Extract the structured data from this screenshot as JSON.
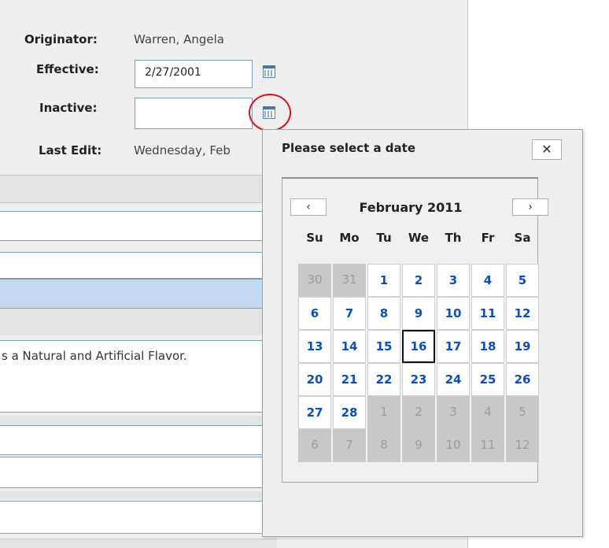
{
  "form": {
    "originator_label": "Originator:",
    "originator_value": "Warren, Angela",
    "effective_label": "Effective:",
    "effective_value": "2/27/2001",
    "inactive_label": "Inactive:",
    "inactive_value": "",
    "last_edit_label": "Last Edit:",
    "last_edit_value": "Wednesday, Feb",
    "description_text": "s a Natural and Artificial Flavor."
  },
  "popup": {
    "title": "Please select a date",
    "close_label": "✕",
    "prev_label": "‹",
    "next_label": "›",
    "month_label": "February 2011",
    "weekdays": [
      "Su",
      "Mo",
      "Tu",
      "We",
      "Th",
      "Fr",
      "Sa"
    ],
    "weeks": [
      [
        {
          "d": "30",
          "cur": false
        },
        {
          "d": "31",
          "cur": false
        },
        {
          "d": "1",
          "cur": true
        },
        {
          "d": "2",
          "cur": true
        },
        {
          "d": "3",
          "cur": true
        },
        {
          "d": "4",
          "cur": true
        },
        {
          "d": "5",
          "cur": true
        }
      ],
      [
        {
          "d": "6",
          "cur": true
        },
        {
          "d": "7",
          "cur": true
        },
        {
          "d": "8",
          "cur": true
        },
        {
          "d": "9",
          "cur": true
        },
        {
          "d": "10",
          "cur": true
        },
        {
          "d": "11",
          "cur": true
        },
        {
          "d": "12",
          "cur": true
        }
      ],
      [
        {
          "d": "13",
          "cur": true
        },
        {
          "d": "14",
          "cur": true
        },
        {
          "d": "15",
          "cur": true
        },
        {
          "d": "16",
          "cur": true,
          "today": true
        },
        {
          "d": "17",
          "cur": true
        },
        {
          "d": "18",
          "cur": true
        },
        {
          "d": "19",
          "cur": true
        }
      ],
      [
        {
          "d": "20",
          "cur": true
        },
        {
          "d": "21",
          "cur": true
        },
        {
          "d": "22",
          "cur": true
        },
        {
          "d": "23",
          "cur": true
        },
        {
          "d": "24",
          "cur": true
        },
        {
          "d": "25",
          "cur": true
        },
        {
          "d": "26",
          "cur": true
        }
      ],
      [
        {
          "d": "27",
          "cur": true
        },
        {
          "d": "28",
          "cur": true
        },
        {
          "d": "1",
          "cur": false
        },
        {
          "d": "2",
          "cur": false
        },
        {
          "d": "3",
          "cur": false
        },
        {
          "d": "4",
          "cur": false
        },
        {
          "d": "5",
          "cur": false
        }
      ],
      [
        {
          "d": "6",
          "cur": false
        },
        {
          "d": "7",
          "cur": false
        },
        {
          "d": "8",
          "cur": false
        },
        {
          "d": "9",
          "cur": false
        },
        {
          "d": "10",
          "cur": false
        },
        {
          "d": "11",
          "cur": false
        },
        {
          "d": "12",
          "cur": false
        }
      ]
    ]
  },
  "icons": {
    "effective_calendar": "calendar-icon",
    "inactive_calendar": "calendar-icon",
    "close": "close-icon"
  },
  "colors": {
    "link_blue": "#0a4ec0",
    "highlight_red": "#e01010",
    "selection_row": "#c3d9ef"
  }
}
